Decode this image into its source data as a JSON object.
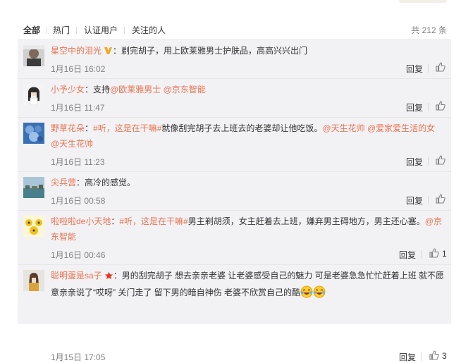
{
  "tabs": [
    "全部",
    "热门",
    "认证用户",
    "关注的人"
  ],
  "total": "共 212 条",
  "reply_label": "回复",
  "comments": [
    {
      "name": "星空中的泪光",
      "sep": "：",
      "body": "剃完胡子，用上欧莱雅男士护肤品，高高兴兴出门",
      "time": "1月16日 16:02",
      "verified_badge": "orange-v-icon"
    },
    {
      "name": "小予少女",
      "sep": "：",
      "body": "支持",
      "links": [
        "@欧莱雅男士",
        "@京东智能"
      ],
      "time": "1月16日 11:47"
    },
    {
      "name": "野草花朵",
      "sep": "：",
      "topic": "#听，这是在干嘛#",
      "body": "就像刮完胡子去上班去的老婆却让他吃饭。",
      "links": [
        "@天生花帅",
        "@爱家爱生活的女",
        "@天生花帅"
      ],
      "time": "1月16日 11:23"
    },
    {
      "name": "尖兵营",
      "sep": "：",
      "body": "高冷的感觉。",
      "time": "1月16日 00:58"
    },
    {
      "name": "啦啦啦de小天地",
      "sep": "：",
      "topic": "#听，这是在干嘛#",
      "body": "男主剃胡须，女主赶着去上班，嫌弃男主碍地方，男主还心塞。",
      "links": [
        "@京东智能"
      ],
      "time": "1月16日 00:46",
      "likes": "1"
    },
    {
      "name": "聪明蛋是sa子",
      "sep": "：",
      "body_line1": "男的刮完胡子 想去亲亲老婆 让老婆感受自己的魅力 可是老婆急急忙忙赶着上班 就不愿",
      "body_line2": "意亲亲说了“哎呀” 关门走了 留下男的暗自神伤 老婆不欣赏自己的酷",
      "time": "1月15日 17:05",
      "likes": "3",
      "member_badge": "red-star-icon",
      "emoji": [
        "laughing-crying-emoji",
        "laughing-crying-emoji"
      ]
    }
  ]
}
